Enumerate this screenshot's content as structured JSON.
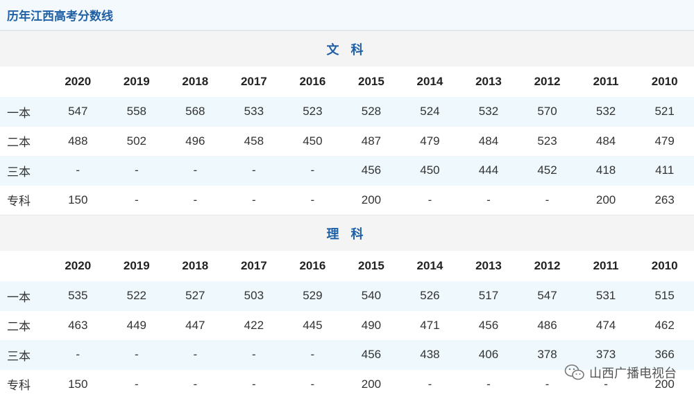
{
  "page_title": "历年江西高考分数线",
  "years": [
    "2020",
    "2019",
    "2018",
    "2017",
    "2016",
    "2015",
    "2014",
    "2013",
    "2012",
    "2011",
    "2010"
  ],
  "sections": [
    {
      "name": "文 科",
      "rows": [
        {
          "label": "一本",
          "values": [
            "547",
            "558",
            "568",
            "533",
            "523",
            "528",
            "524",
            "532",
            "570",
            "532",
            "521"
          ]
        },
        {
          "label": "二本",
          "values": [
            "488",
            "502",
            "496",
            "458",
            "450",
            "487",
            "479",
            "484",
            "523",
            "484",
            "479"
          ]
        },
        {
          "label": "三本",
          "values": [
            "-",
            "-",
            "-",
            "-",
            "-",
            "456",
            "450",
            "444",
            "452",
            "418",
            "411"
          ]
        },
        {
          "label": "专科",
          "values": [
            "150",
            "-",
            "-",
            "-",
            "-",
            "200",
            "-",
            "-",
            "-",
            "200",
            "263"
          ]
        }
      ]
    },
    {
      "name": "理 科",
      "rows": [
        {
          "label": "一本",
          "values": [
            "535",
            "522",
            "527",
            "503",
            "529",
            "540",
            "526",
            "517",
            "547",
            "531",
            "515"
          ]
        },
        {
          "label": "二本",
          "values": [
            "463",
            "449",
            "447",
            "422",
            "445",
            "490",
            "471",
            "456",
            "486",
            "474",
            "462"
          ]
        },
        {
          "label": "三本",
          "values": [
            "-",
            "-",
            "-",
            "-",
            "-",
            "456",
            "438",
            "406",
            "378",
            "373",
            "366"
          ]
        },
        {
          "label": "专科",
          "values": [
            "150",
            "-",
            "-",
            "-",
            "-",
            "200",
            "-",
            "-",
            "-",
            "-",
            "200"
          ]
        }
      ]
    }
  ],
  "watermark": {
    "text": "山西广播电视台",
    "icon": "wechat-icon"
  }
}
